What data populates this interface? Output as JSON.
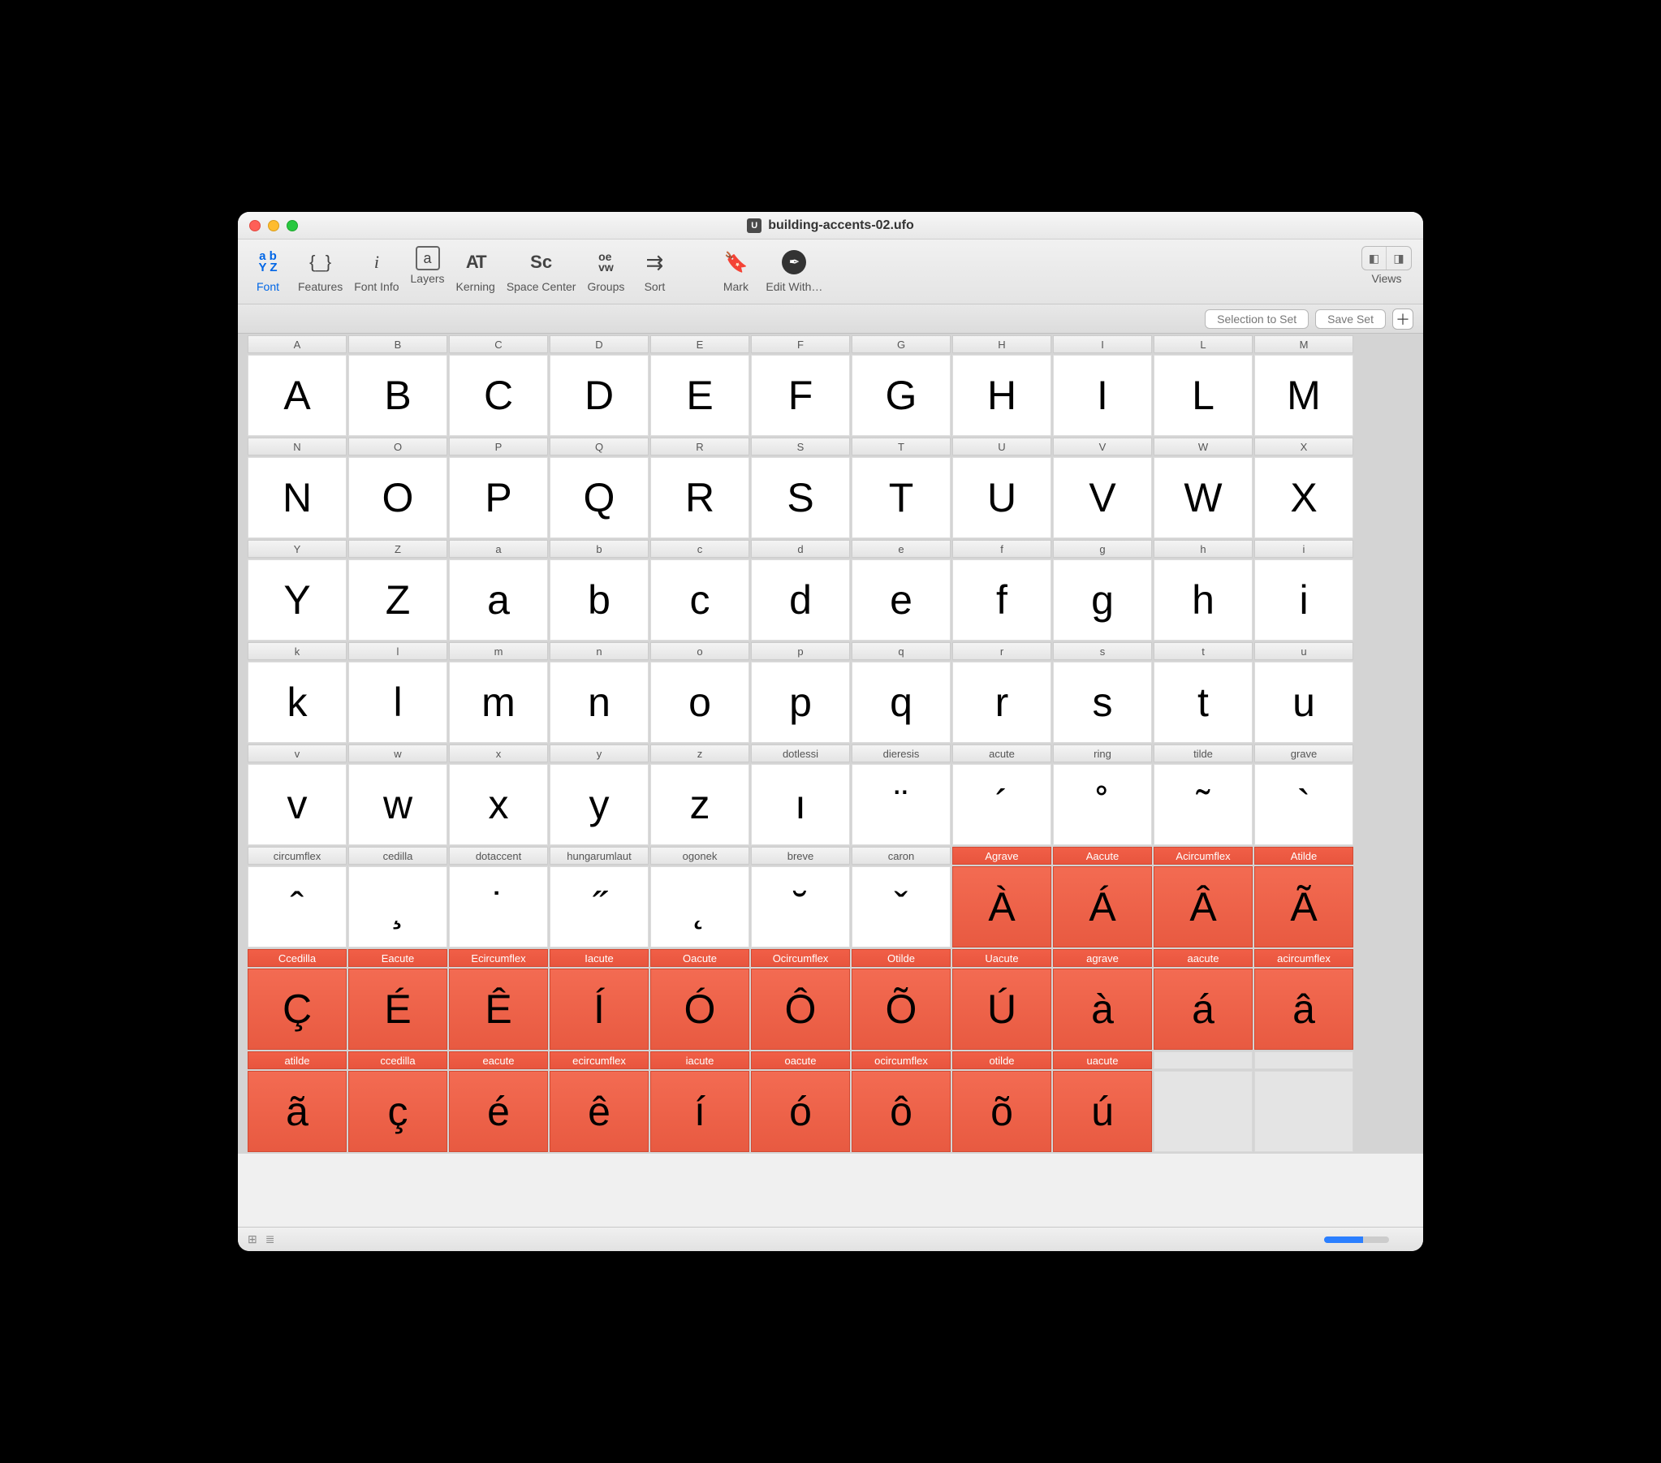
{
  "window": {
    "title": "building-accents-02.ufo",
    "icon_label": "U"
  },
  "traffic": {
    "close": "close",
    "min": "minimize",
    "max": "maximize"
  },
  "toolbar": {
    "font": {
      "label": "Font",
      "glyph": "a b\nY Z"
    },
    "features": {
      "label": "Features",
      "glyph": "{_}"
    },
    "fontinfo": {
      "label": "Font Info",
      "glyph": "i"
    },
    "layers": {
      "label": "Layers",
      "glyph": "a"
    },
    "kerning": {
      "label": "Kerning",
      "glyph": "AT"
    },
    "spacecenter": {
      "label": "Space Center",
      "glyph": "Sc"
    },
    "groups": {
      "label": "Groups",
      "glyph": "oe\nvw"
    },
    "sort": {
      "label": "Sort",
      "glyph": "⇄"
    },
    "mark": {
      "label": "Mark",
      "glyph": "◆"
    },
    "editwith": {
      "label": "Edit With…",
      "glyph": "✒"
    },
    "views": {
      "label": "Views"
    }
  },
  "secbar": {
    "selection_to_set": "Selection to Set",
    "save_set": "Save Set",
    "plus": "＋"
  },
  "footer": {
    "grid_icon": "⊞",
    "list_icon": "≣"
  },
  "cells": [
    {
      "name": "A",
      "glyph": "A",
      "marked": false
    },
    {
      "name": "B",
      "glyph": "B",
      "marked": false
    },
    {
      "name": "C",
      "glyph": "C",
      "marked": false
    },
    {
      "name": "D",
      "glyph": "D",
      "marked": false
    },
    {
      "name": "E",
      "glyph": "E",
      "marked": false
    },
    {
      "name": "F",
      "glyph": "F",
      "marked": false
    },
    {
      "name": "G",
      "glyph": "G",
      "marked": false
    },
    {
      "name": "H",
      "glyph": "H",
      "marked": false
    },
    {
      "name": "I",
      "glyph": "I",
      "marked": false
    },
    {
      "name": "L",
      "glyph": "L",
      "marked": false
    },
    {
      "name": "M",
      "glyph": "M",
      "marked": false
    },
    {
      "name": "N",
      "glyph": "N",
      "marked": false
    },
    {
      "name": "O",
      "glyph": "O",
      "marked": false
    },
    {
      "name": "P",
      "glyph": "P",
      "marked": false
    },
    {
      "name": "Q",
      "glyph": "Q",
      "marked": false
    },
    {
      "name": "R",
      "glyph": "R",
      "marked": false
    },
    {
      "name": "S",
      "glyph": "S",
      "marked": false
    },
    {
      "name": "T",
      "glyph": "T",
      "marked": false
    },
    {
      "name": "U",
      "glyph": "U",
      "marked": false
    },
    {
      "name": "V",
      "glyph": "V",
      "marked": false
    },
    {
      "name": "W",
      "glyph": "W",
      "marked": false
    },
    {
      "name": "X",
      "glyph": "X",
      "marked": false
    },
    {
      "name": "Y",
      "glyph": "Y",
      "marked": false
    },
    {
      "name": "Z",
      "glyph": "Z",
      "marked": false
    },
    {
      "name": "a",
      "glyph": "a",
      "marked": false
    },
    {
      "name": "b",
      "glyph": "b",
      "marked": false
    },
    {
      "name": "c",
      "glyph": "c",
      "marked": false
    },
    {
      "name": "d",
      "glyph": "d",
      "marked": false
    },
    {
      "name": "e",
      "glyph": "e",
      "marked": false
    },
    {
      "name": "f",
      "glyph": "f",
      "marked": false
    },
    {
      "name": "g",
      "glyph": "g",
      "marked": false
    },
    {
      "name": "h",
      "glyph": "h",
      "marked": false
    },
    {
      "name": "i",
      "glyph": "i",
      "marked": false
    },
    {
      "name": "k",
      "glyph": "k",
      "marked": false
    },
    {
      "name": "l",
      "glyph": "l",
      "marked": false
    },
    {
      "name": "m",
      "glyph": "m",
      "marked": false
    },
    {
      "name": "n",
      "glyph": "n",
      "marked": false
    },
    {
      "name": "o",
      "glyph": "o",
      "marked": false
    },
    {
      "name": "p",
      "glyph": "p",
      "marked": false
    },
    {
      "name": "q",
      "glyph": "q",
      "marked": false
    },
    {
      "name": "r",
      "glyph": "r",
      "marked": false
    },
    {
      "name": "s",
      "glyph": "s",
      "marked": false
    },
    {
      "name": "t",
      "glyph": "t",
      "marked": false
    },
    {
      "name": "u",
      "glyph": "u",
      "marked": false
    },
    {
      "name": "v",
      "glyph": "v",
      "marked": false
    },
    {
      "name": "w",
      "glyph": "w",
      "marked": false
    },
    {
      "name": "x",
      "glyph": "x",
      "marked": false
    },
    {
      "name": "y",
      "glyph": "y",
      "marked": false
    },
    {
      "name": "z",
      "glyph": "z",
      "marked": false
    },
    {
      "name": "dotlessi",
      "glyph": "ı",
      "marked": false
    },
    {
      "name": "dieresis",
      "glyph": "¨",
      "marked": false
    },
    {
      "name": "acute",
      "glyph": "´",
      "marked": false
    },
    {
      "name": "ring",
      "glyph": "˚",
      "marked": false
    },
    {
      "name": "tilde",
      "glyph": "˜",
      "marked": false
    },
    {
      "name": "grave",
      "glyph": "`",
      "marked": false
    },
    {
      "name": "circumflex",
      "glyph": "ˆ",
      "marked": false
    },
    {
      "name": "cedilla",
      "glyph": "¸",
      "marked": false
    },
    {
      "name": "dotaccent",
      "glyph": "˙",
      "marked": false
    },
    {
      "name": "hungarumlaut",
      "glyph": "˝",
      "marked": false
    },
    {
      "name": "ogonek",
      "glyph": "˛",
      "marked": false
    },
    {
      "name": "breve",
      "glyph": "˘",
      "marked": false
    },
    {
      "name": "caron",
      "glyph": "ˇ",
      "marked": false
    },
    {
      "name": "Agrave",
      "glyph": "À",
      "marked": true
    },
    {
      "name": "Aacute",
      "glyph": "Á",
      "marked": true
    },
    {
      "name": "Acircumflex",
      "glyph": "Â",
      "marked": true
    },
    {
      "name": "Atilde",
      "glyph": "Ã",
      "marked": true
    },
    {
      "name": "Ccedilla",
      "glyph": "Ç",
      "marked": true
    },
    {
      "name": "Eacute",
      "glyph": "É",
      "marked": true
    },
    {
      "name": "Ecircumflex",
      "glyph": "Ê",
      "marked": true
    },
    {
      "name": "Iacute",
      "glyph": "Í",
      "marked": true
    },
    {
      "name": "Oacute",
      "glyph": "Ó",
      "marked": true
    },
    {
      "name": "Ocircumflex",
      "glyph": "Ô",
      "marked": true
    },
    {
      "name": "Otilde",
      "glyph": "Õ",
      "marked": true
    },
    {
      "name": "Uacute",
      "glyph": "Ú",
      "marked": true
    },
    {
      "name": "agrave",
      "glyph": "à",
      "marked": true
    },
    {
      "name": "aacute",
      "glyph": "á",
      "marked": true
    },
    {
      "name": "acircumflex",
      "glyph": "â",
      "marked": true
    },
    {
      "name": "atilde",
      "glyph": "ã",
      "marked": true
    },
    {
      "name": "ccedilla",
      "glyph": "ç",
      "marked": true
    },
    {
      "name": "eacute",
      "glyph": "é",
      "marked": true
    },
    {
      "name": "ecircumflex",
      "glyph": "ê",
      "marked": true
    },
    {
      "name": "iacute",
      "glyph": "í",
      "marked": true
    },
    {
      "name": "oacute",
      "glyph": "ó",
      "marked": true
    },
    {
      "name": "ocircumflex",
      "glyph": "ô",
      "marked": true
    },
    {
      "name": "otilde",
      "glyph": "õ",
      "marked": true
    },
    {
      "name": "uacute",
      "glyph": "ú",
      "marked": true
    }
  ]
}
